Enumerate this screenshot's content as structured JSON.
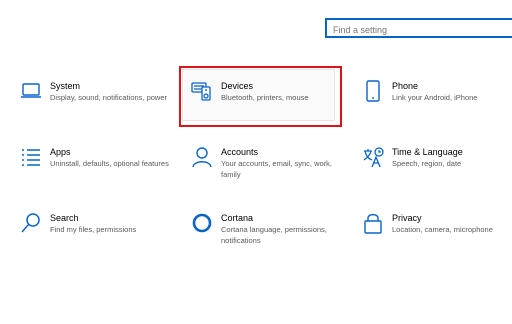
{
  "search": {
    "placeholder": "Find a setting"
  },
  "tiles": [
    {
      "title": "System",
      "desc": "Display, sound, notifications, power",
      "icon": "laptop-icon"
    },
    {
      "title": "Devices",
      "desc": "Bluetooth, printers, mouse",
      "icon": "keyboard-devices-icon"
    },
    {
      "title": "Phone",
      "desc": "Link your Android, iPhone",
      "icon": "phone-icon"
    },
    {
      "title": "Apps",
      "desc": "Uninstall, defaults, optional features",
      "icon": "apps-list-icon"
    },
    {
      "title": "Accounts",
      "desc": "Your accounts, email, sync, work, family",
      "icon": "person-icon"
    },
    {
      "title": "Time & Language",
      "desc": "Speech, region, date",
      "icon": "time-language-icon"
    },
    {
      "title": "Search",
      "desc": "Find my files, permissions",
      "icon": "magnifier-icon"
    },
    {
      "title": "Cortana",
      "desc": "Cortana language, permissions, notifications",
      "icon": "cortana-circle-icon"
    },
    {
      "title": "Privacy",
      "desc": "Location, camera, microphone",
      "icon": "lock-icon"
    }
  ],
  "colors": {
    "accent": "#0a64c8",
    "highlight": "#d9141b"
  }
}
